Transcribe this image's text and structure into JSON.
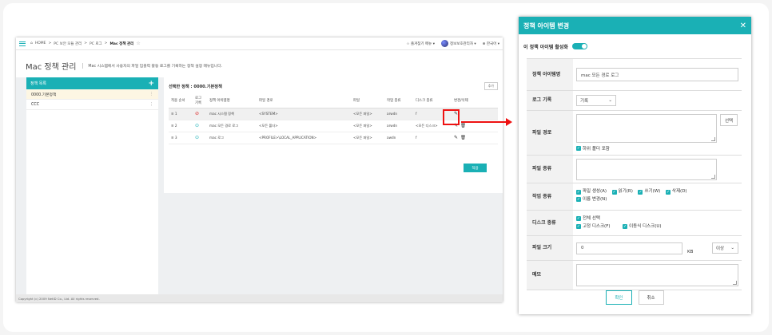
{
  "app": {
    "breadcrumb": [
      "HOME",
      "PC 보안 모듈 관리",
      "PC 로그",
      "Mac 정책 관리"
    ],
    "top_right": {
      "favorites": "즐겨찾기 메뉴",
      "user": "정보보호관리자",
      "language": "한국어"
    },
    "page_title": "Mac 정책 관리",
    "page_desc": "Mac 시스템에서 사용자의 파일 입출력 활동 로그를 기록하는 정책 설정 메뉴입니다.",
    "left_panel": {
      "title": "정책 목록",
      "items": [
        "0000.기본정책",
        "CCC"
      ]
    },
    "right_panel": {
      "title": "선택한 정책 : 0000.기본정책",
      "small_button": "추가",
      "columns": [
        "적용 순서",
        "로그 기록",
        "정책 아이템명",
        "파일 경로",
        "파일",
        "작업 종류",
        "디스크 종류",
        "변경/삭제"
      ],
      "rows": [
        {
          "order": "1",
          "item": "mac 시스템 정책",
          "path": "<SYSTEM>",
          "file": "<모든 파일>",
          "op": "arwdn",
          "disk": "f"
        },
        {
          "order": "2",
          "item": "mac 모든 경로 로그",
          "path": "<모든 폴더>",
          "file": "<모든 파일>",
          "op": "arwdn",
          "disk": "<모든 디스크>"
        },
        {
          "order": "3",
          "item": "mac 로그",
          "path": "<PROFILE>\\LOCAL_APPLICATION>",
          "file": "<모든 파일>",
          "op": "awdn",
          "disk": "f"
        }
      ],
      "apply_button": "적용"
    },
    "footer": "Copyright (c) 2009 NetID Co., Ltd. All rights reserved."
  },
  "dialog": {
    "title": "정책 아이템 변경",
    "toggle_label": "이 정책 아이템 활성화",
    "fields": {
      "name": {
        "label": "정책 아이템명",
        "value": "mac 모든 경로 로그"
      },
      "log": {
        "label": "로그 기록",
        "value": "기록"
      },
      "path": {
        "label": "파일 경로",
        "select_button": "선택",
        "subfolder": "하위 폴더 포함"
      },
      "filetype": {
        "label": "파일 종류"
      },
      "op": {
        "label": "작업 종류",
        "options": [
          "파일 생성(A)",
          "읽기(R)",
          "쓰기(W)",
          "삭제(D)",
          "이름 변경(N)"
        ]
      },
      "disk": {
        "label": "디스크 종류",
        "options": [
          "전체 선택",
          "고정 디스크(F)",
          "이동식 디스크(U)"
        ]
      },
      "size": {
        "label": "파일 크기",
        "value": "0",
        "unit": "KB",
        "compare": "이상"
      },
      "memo": {
        "label": "메모"
      }
    },
    "ok": "확인",
    "cancel": "취소"
  }
}
